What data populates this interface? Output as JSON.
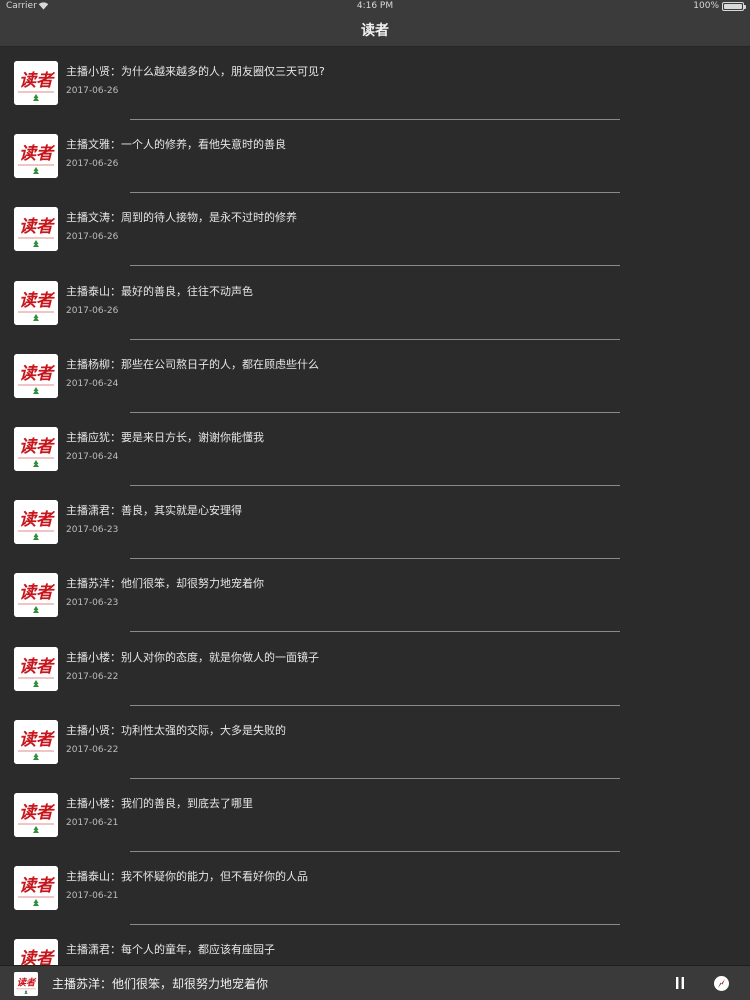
{
  "status_bar": {
    "carrier": "Carrier",
    "time": "4:16 PM",
    "battery": "100%",
    "battery_level": 1.0
  },
  "nav": {
    "title": "读者"
  },
  "icons": {
    "thumbnail": "duzhe-logo-icon",
    "play_state": "pause-icon",
    "navigator": "compass-icon"
  },
  "colors": {
    "background": "#2b2b2b",
    "bar": "#3b3b3b",
    "logo_red": "#c8161d",
    "logo_green": "#2f8f3a"
  },
  "items": [
    {
      "title": "主播小贤：为什么越来越多的人，朋友圈仅三天可见?",
      "date": "2017-06-26"
    },
    {
      "title": "主播文雅：一个人的修养，看他失意时的善良",
      "date": "2017-06-26"
    },
    {
      "title": "主播文涛：周到的待人接物，是永不过时的修养",
      "date": "2017-06-26"
    },
    {
      "title": "主播泰山：最好的善良，往往不动声色",
      "date": "2017-06-26"
    },
    {
      "title": "主播杨柳：那些在公司熬日子的人，都在顾虑些什么",
      "date": "2017-06-24"
    },
    {
      "title": "主播应犹：要是来日方长，谢谢你能懂我",
      "date": "2017-06-24"
    },
    {
      "title": "主播潇君：善良，其实就是心安理得",
      "date": "2017-06-23"
    },
    {
      "title": "主播苏洋：他们很笨，却很努力地宠着你",
      "date": "2017-06-23"
    },
    {
      "title": "主播小楼：别人对你的态度，就是你做人的一面镜子",
      "date": "2017-06-22"
    },
    {
      "title": "主播小贤：功利性太强的交际，大多是失败的",
      "date": "2017-06-22"
    },
    {
      "title": "主播小楼：我们的善良，到底去了哪里",
      "date": "2017-06-21"
    },
    {
      "title": "主播泰山：我不怀疑你的能力，但不看好你的人品",
      "date": "2017-06-21"
    },
    {
      "title": "主播潇君：每个人的童年，都应该有座园子",
      "date": ""
    }
  ],
  "player": {
    "now_playing": "主播苏洋：他们很笨，却很努力地宠着你"
  }
}
